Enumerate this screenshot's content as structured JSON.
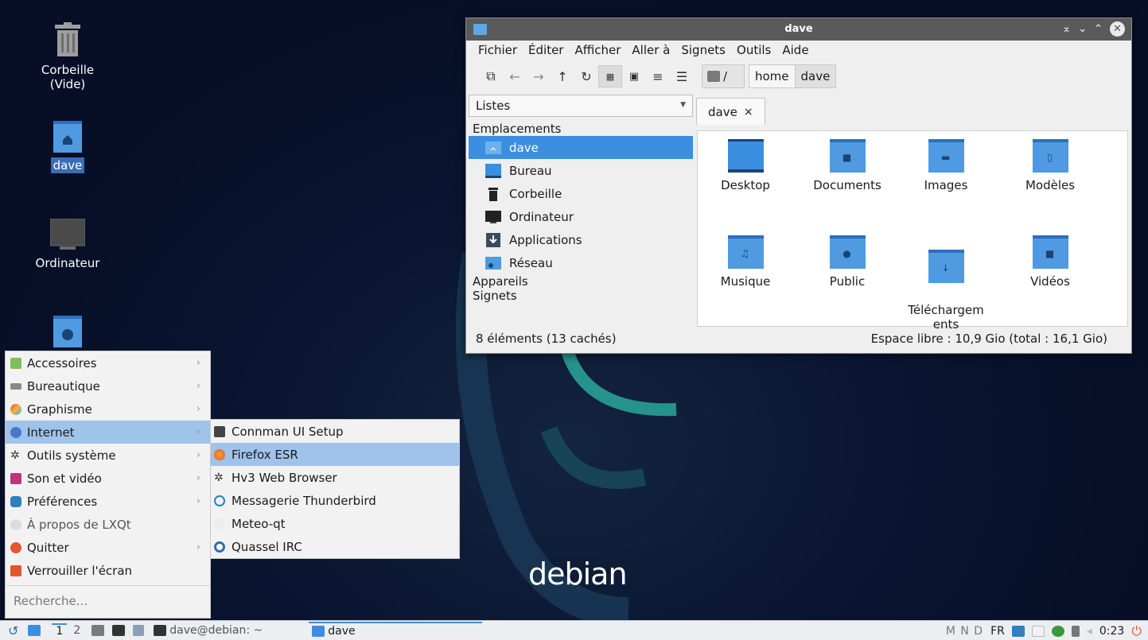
{
  "desktop": {
    "icons": [
      {
        "label": "Corbeille\n(Vide)"
      },
      {
        "label": "dave"
      },
      {
        "label": "Ordinateur"
      },
      {
        "label": ""
      }
    ],
    "logo": "debian"
  },
  "window": {
    "title": "dave",
    "title_buttons": [
      "⌅",
      "⌄",
      "⌃",
      "✕"
    ],
    "menus": [
      "Fichier",
      "Éditer",
      "Afficher",
      "Aller à",
      "Signets",
      "Outils",
      "Aide"
    ],
    "path": {
      "root": "/",
      "segments": [
        "home",
        "dave"
      ]
    },
    "side_panel": {
      "mode": "Listes",
      "places_header": "Emplacements",
      "places": [
        "dave",
        "Bureau",
        "Corbeille",
        "Ordinateur",
        "Applications",
        "Réseau"
      ],
      "devices_header": "Appareils",
      "bookmarks_header": "Signets"
    },
    "tab": {
      "label": "dave",
      "close": "×"
    },
    "items": [
      "Desktop",
      "Documents",
      "Images",
      "Modèles",
      "Musique",
      "Public",
      "Téléchargem\nents",
      "Vidéos"
    ],
    "status": {
      "left": "8 éléments (13 cachés)",
      "right": "Espace libre : 10,9 Gio (total : 16,1 Gio)"
    }
  },
  "start_menu": {
    "items": [
      {
        "label": "Accessoires",
        "icon": "accessories-icon"
      },
      {
        "label": "Bureautique",
        "icon": "office-icon"
      },
      {
        "label": "Graphisme",
        "icon": "graphics-icon"
      },
      {
        "label": "Internet",
        "icon": "internet-icon"
      },
      {
        "label": "Outils système",
        "icon": "system-tools-icon"
      },
      {
        "label": "Son et vidéo",
        "icon": "multimedia-icon"
      },
      {
        "label": "Préférences",
        "icon": "preferences-icon"
      },
      {
        "label": "À propos de LXQt",
        "icon": "about-icon"
      },
      {
        "label": "Quitter",
        "icon": "quit-icon"
      },
      {
        "label": "Verrouiller l'écran",
        "icon": "lock-icon"
      }
    ],
    "search_placeholder": "Recherche..."
  },
  "submenu": {
    "items": [
      "Connman UI Setup",
      "Firefox ESR",
      "Hv3 Web Browser",
      "Messagerie Thunderbird",
      "Meteo-qt",
      "Quassel IRC"
    ]
  },
  "taskbar": {
    "desktops": [
      "1",
      "2"
    ],
    "tasks": [
      "dave@debian: ~",
      "dave"
    ],
    "kbd_indicators": "M N D",
    "layout": "FR",
    "clock": "0:23"
  },
  "colors": {
    "selection": "#3c8fe0",
    "menu_highlight": "#9fc3ea",
    "folder": "#4f9ae0"
  }
}
